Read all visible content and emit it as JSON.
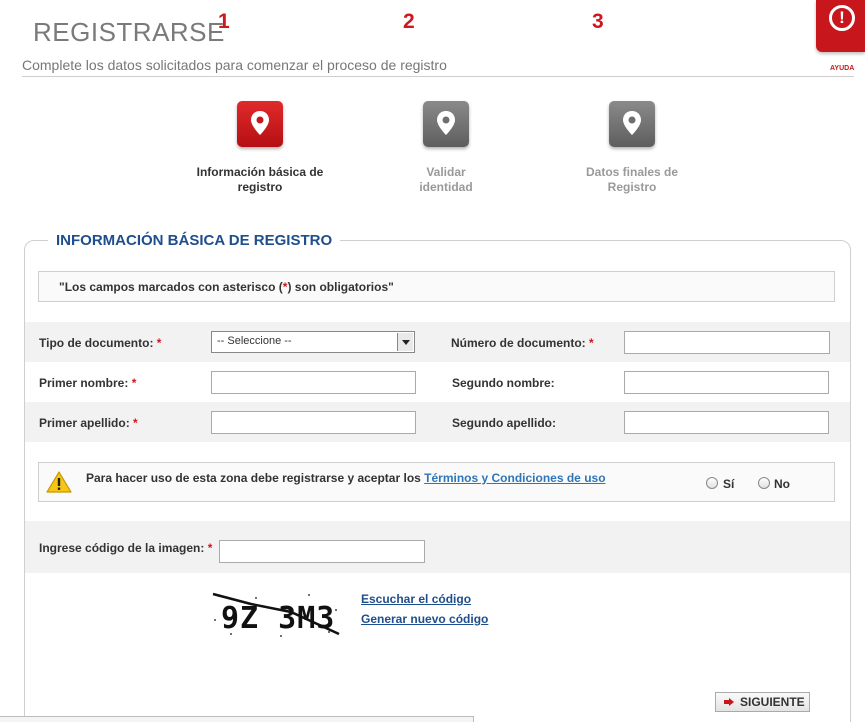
{
  "header": {
    "title": "REGISTRARSE",
    "subtitle": "Complete los datos solicitados para comenzar el proceso de registro",
    "help_label": "AYUDA",
    "help_icon": "!"
  },
  "steps": [
    {
      "number": "1",
      "label_line1": "Información básica de",
      "label_line2": "registro",
      "state": "active",
      "icon": "map-pin-icon"
    },
    {
      "number": "2",
      "label_line1": "Validar",
      "label_line2": "identidad",
      "state": "inactive",
      "icon": "map-pin-icon"
    },
    {
      "number": "3",
      "label_line1": "Datos finales de",
      "label_line2": "Registro",
      "state": "inactive",
      "icon": "map-pin-icon"
    }
  ],
  "section": {
    "title": "INFORMACIÓN BÁSICA DE REGISTRO",
    "notice_pre": "\"Los campos marcados con asterisco (",
    "notice_ast": "*",
    "notice_post": ") son obligatorios\""
  },
  "form": {
    "required_mark": "*",
    "doc_type_label": "Tipo de documento:",
    "doc_type_value": "-- Seleccione --",
    "doc_number_label": "Número de documento:",
    "first_name_label": "Primer nombre:",
    "second_name_label": "Segundo nombre:",
    "first_lastname_label": "Primer apellido:",
    "second_lastname_label": "Segundo apellido:"
  },
  "terms": {
    "text": "Para hacer uso de esta zona debe registrarse y aceptar los ",
    "link": "Términos y Condiciones de uso",
    "yes": "Sí",
    "no": "No"
  },
  "captcha": {
    "label": "Ingrese código de la imagen:",
    "image_text": "9Z 3M3",
    "listen_link": "Escuchar el código",
    "regenerate_link": "Generar nuevo código"
  },
  "actions": {
    "next": "SIGUIENTE"
  },
  "colors": {
    "brand_red": "#c8171c",
    "title_blue": "#1f4e8c",
    "link_blue": "#2e76b8"
  }
}
